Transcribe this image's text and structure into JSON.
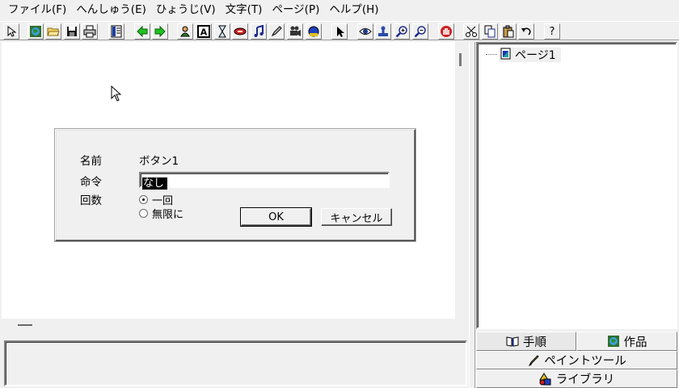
{
  "menu": [
    "ファイル(F)",
    "へんしゅう(E)",
    "ひょうじ(V)",
    "文字(T)",
    "ページ(P)",
    "ヘルプ(H)"
  ],
  "toolbar": {
    "help_glyph": "?"
  },
  "tree": {
    "root_label": "ページ1"
  },
  "dialog": {
    "name_label": "名前",
    "name_value": "ボタン1",
    "command_label": "命令",
    "command_value": "なし",
    "count_label": "回数",
    "radio_once": "一回",
    "radio_infinite": "無限に",
    "ok_label": "OK",
    "cancel_label": "キャンセル"
  },
  "tabs": {
    "procedure": "手順",
    "works": "作品",
    "paint_tool": "ペイントツール",
    "library": "ライブラリ"
  },
  "colors": {
    "window_bg": "#f0f0f0",
    "canvas_bg": "#ffffff"
  }
}
